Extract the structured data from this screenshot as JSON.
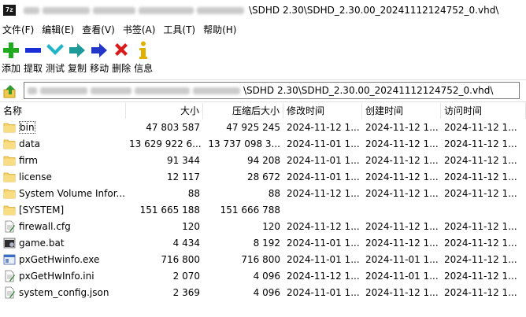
{
  "window": {
    "app_icon_text": "7z",
    "title": "\\SDHD 2.30\\SDHD_2.30.00_20241112124752_0.vhd\\"
  },
  "menu": [
    {
      "label": "文件(F)"
    },
    {
      "label": "编辑(E)"
    },
    {
      "label": "查看(V)"
    },
    {
      "label": "书签(A)"
    },
    {
      "label": "工具(T)"
    },
    {
      "label": "帮助(H)"
    }
  ],
  "toolbar": [
    {
      "label": "添加",
      "icon": "plus-icon",
      "color": "#1faa1f"
    },
    {
      "label": "提取",
      "icon": "minus-icon",
      "color": "#1b2fd8"
    },
    {
      "label": "测试",
      "icon": "check-icon",
      "color": "#22b5c9"
    },
    {
      "label": "复制",
      "icon": "copy-arrow-icon",
      "color": "#1e9a9a"
    },
    {
      "label": "移动",
      "icon": "move-arrow-icon",
      "color": "#2336c9"
    },
    {
      "label": "删除",
      "icon": "delete-x-icon",
      "color": "#d81b1b"
    },
    {
      "label": "信息",
      "icon": "info-icon",
      "color": "#e2b100"
    }
  ],
  "address": {
    "path": "\\SDHD 2.30\\SDHD_2.30.00_20241112124752_0.vhd\\"
  },
  "columns": [
    {
      "key": "name",
      "label": "名称"
    },
    {
      "key": "size",
      "label": "大小"
    },
    {
      "key": "packed",
      "label": "压缩后大小"
    },
    {
      "key": "modified",
      "label": "修改时间"
    },
    {
      "key": "created",
      "label": "创建时间"
    },
    {
      "key": "accessed",
      "label": "访问时间"
    }
  ],
  "files": [
    {
      "name": "bin",
      "type": "folder",
      "size": "47 803 587",
      "packed": "47 925 245",
      "modified": "2024-11-12 1...",
      "created": "2024-11-12 1...",
      "accessed": "2024-11-12 1..."
    },
    {
      "name": "data",
      "type": "folder",
      "size": "13 629 922 6...",
      "packed": "13 737 098 3...",
      "modified": "2024-11-01 1...",
      "created": "2024-11-12 1...",
      "accessed": "2024-11-12 1..."
    },
    {
      "name": "firm",
      "type": "folder",
      "size": "91 344",
      "packed": "94 208",
      "modified": "2024-11-01 1...",
      "created": "2024-11-12 1...",
      "accessed": "2024-11-12 1..."
    },
    {
      "name": "license",
      "type": "folder",
      "size": "12 117",
      "packed": "28 672",
      "modified": "2024-11-01 1...",
      "created": "2024-11-12 1...",
      "accessed": "2024-11-12 1..."
    },
    {
      "name": "System Volume Infor...",
      "type": "folder",
      "size": "88",
      "packed": "88",
      "modified": "2024-11-12 1...",
      "created": "2024-11-12 1...",
      "accessed": "2024-11-12 1..."
    },
    {
      "name": "[SYSTEM]",
      "type": "folder",
      "size": "151 665 188",
      "packed": "151 666 788",
      "modified": "",
      "created": "",
      "accessed": ""
    },
    {
      "name": "firewall.cfg",
      "type": "text",
      "size": "120",
      "packed": "120",
      "modified": "2024-11-12 1...",
      "created": "2024-11-12 1...",
      "accessed": "2024-11-12 1..."
    },
    {
      "name": "game.bat",
      "type": "bat",
      "size": "4 434",
      "packed": "8 192",
      "modified": "2024-11-01 1...",
      "created": "2024-11-12 1...",
      "accessed": "2024-11-12 1..."
    },
    {
      "name": "pxGetHwinfo.exe",
      "type": "exe",
      "size": "716 800",
      "packed": "716 800",
      "modified": "2024-11-01 1...",
      "created": "2024-11-01 1...",
      "accessed": "2024-11-12 1..."
    },
    {
      "name": "pxGetHwInfo.ini",
      "type": "text",
      "size": "2 070",
      "packed": "4 096",
      "modified": "2024-11-12 1...",
      "created": "2024-11-01 1...",
      "accessed": "2024-11-12 1..."
    },
    {
      "name": "system_config.json",
      "type": "text",
      "size": "2 369",
      "packed": "4 096",
      "modified": "2024-11-01 1...",
      "created": "2024-11-12 1...",
      "accessed": "2024-11-12 1..."
    }
  ]
}
